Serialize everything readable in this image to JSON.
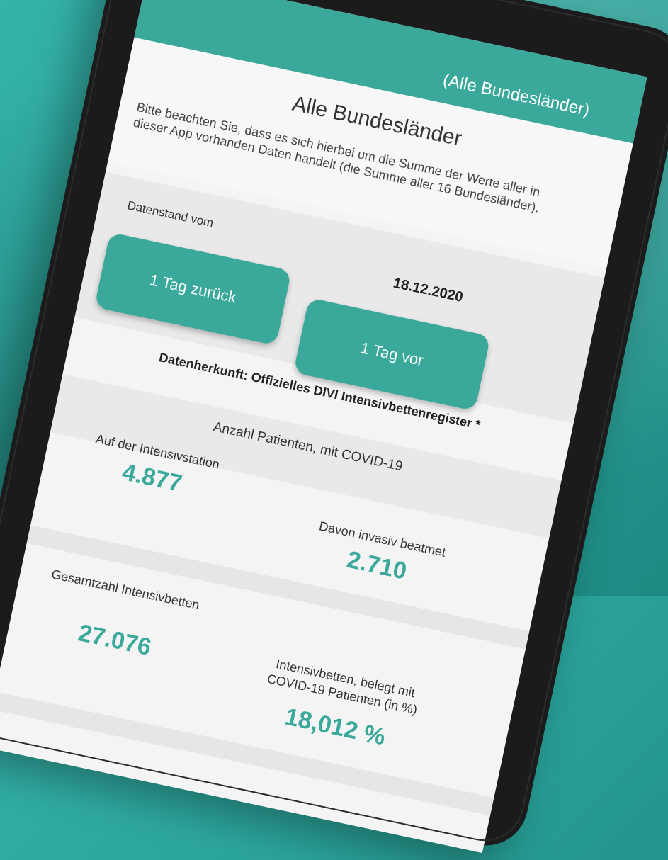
{
  "appbar": {
    "title": "(Alle Bundesländer)"
  },
  "intro": {
    "title": "Alle Bundesländer",
    "note": "Bitte beachten Sie, dass es sich hierbei um die Summe der Werte aller in dieser App vorhanden Daten handelt (die Summe aller 16 Bundesländer)."
  },
  "datenstand": {
    "label": "Datenstand vom",
    "date": "18.12.2020"
  },
  "nav": {
    "back_label": "1 Tag zurück",
    "forward_label": "1 Tag vor"
  },
  "source": "Datenherkunft: Offizielles DIVI Intensivbettenregister *",
  "patients": {
    "heading": "Anzahl Patienten, mit COVID-19",
    "icu_label": "Auf der Intensivstation",
    "icu_value": "4.877",
    "ventilated_label": "Davon invasiv beatmet",
    "ventilated_value": "2.710"
  },
  "beds": {
    "total_label": "Gesamtzahl Intensivbetten",
    "total_value": "27.076",
    "covid_label_1": "Intensivbetten, belegt mit",
    "covid_label_2": "COVID-19 Patienten (in %)",
    "covid_value": "18,012 %"
  },
  "colors": {
    "accent": "#3aa99b",
    "background": "#2aa39a"
  }
}
